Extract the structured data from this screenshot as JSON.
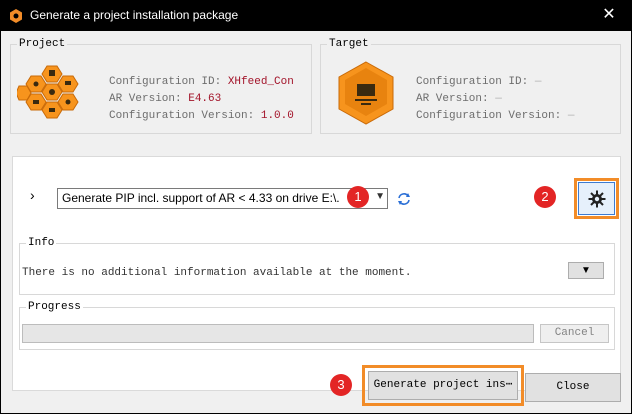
{
  "window": {
    "title": "Generate a project installation package",
    "close_label": "✕"
  },
  "project": {
    "group_label": "Project",
    "config_id_label": "Configuration ID:",
    "config_id_value": "XHfeed_Con",
    "ar_version_label": "AR Version:",
    "ar_version_value": "E4.63",
    "config_version_label": "Configuration Version:",
    "config_version_value": "1.0.0"
  },
  "target": {
    "group_label": "Target",
    "config_id_label": "Configuration ID:",
    "config_id_value": "—",
    "ar_version_label": "AR Version:",
    "ar_version_value": "—",
    "config_version_label": "Configuration Version:",
    "config_version_value": "—"
  },
  "options": {
    "expander": "›",
    "dropdown_value": "Generate PIP incl. support of AR < 4.33 on drive E:\\.",
    "badge_1": "1",
    "badge_2": "2",
    "badge_3": "3"
  },
  "info": {
    "group_label": "Info",
    "text": "There is no additional information available at the moment.",
    "expand_glyph": "▼"
  },
  "progress": {
    "group_label": "Progress",
    "value": 0,
    "cancel_label": "Cancel"
  },
  "footer": {
    "generate_label": "Generate project ins⋯",
    "close_label": "Close"
  },
  "colors": {
    "accent_orange": "#f28c28",
    "badge_red": "#e32525",
    "value_red": "#a3142a",
    "title_bar": "#000000"
  }
}
